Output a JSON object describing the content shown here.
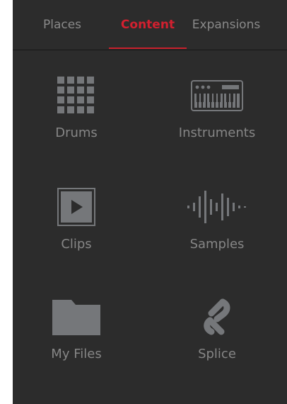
{
  "tabs": [
    {
      "label": "Places",
      "active": false
    },
    {
      "label": "Content",
      "active": true
    },
    {
      "label": "Expansions",
      "active": false
    }
  ],
  "content": {
    "items": [
      {
        "label": "Drums",
        "icon": "drum-pads-grid-icon"
      },
      {
        "label": "Instruments",
        "icon": "keyboard-synth-icon"
      },
      {
        "label": "Clips",
        "icon": "play-clip-icon"
      },
      {
        "label": "Samples",
        "icon": "waveform-icon"
      },
      {
        "label": "My Files",
        "icon": "folder-icon"
      },
      {
        "label": "Splice",
        "icon": "splice-logo-icon"
      }
    ]
  },
  "colors": {
    "panel_background": "#2c2c2c",
    "accent": "#d2202f",
    "icon": "#75777a",
    "text": "#868686"
  }
}
